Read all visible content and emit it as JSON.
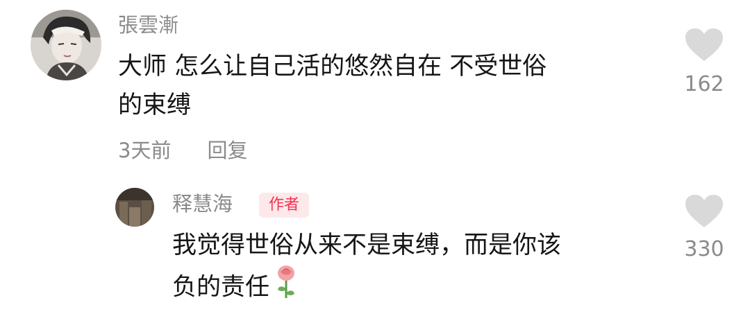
{
  "comment": {
    "username": "張雲漸",
    "text_lines": [
      "大师 怎么让自己活的悠然自在 不受世俗",
      "的束缚"
    ],
    "time": "3天前",
    "reply_label": "回复",
    "likes": "162"
  },
  "reply": {
    "username": "释慧海",
    "badge": "作者",
    "text_lines": [
      "我觉得世俗从来不是束缚，而是你该",
      "负的责任"
    ],
    "emoji": "rose-icon",
    "likes": "330"
  },
  "colors": {
    "secondary_text": "#8a8a8a",
    "primary_text": "#161616",
    "badge_text": "#f2334e",
    "badge_bg": "#fde8ea",
    "heart": "#d9d9d9"
  }
}
